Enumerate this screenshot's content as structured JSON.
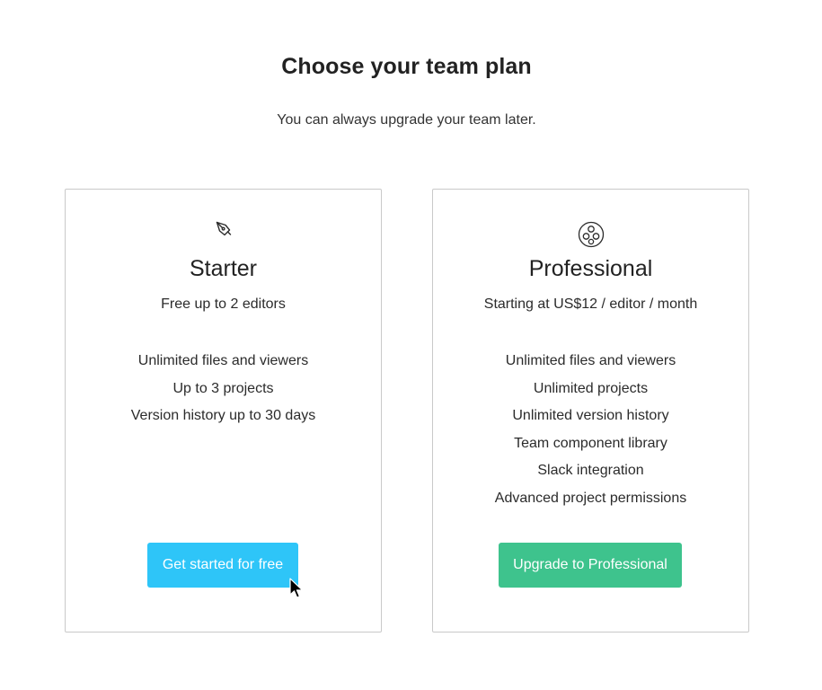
{
  "header": {
    "title": "Choose your team plan",
    "subtitle": "You can always upgrade your team later."
  },
  "plans": [
    {
      "icon": "pen-tool-icon",
      "name": "Starter",
      "price": "Free up to 2 editors",
      "features": [
        "Unlimited files and viewers",
        "Up to 3 projects",
        "Version history up to 30 days"
      ],
      "cta_label": "Get started for free",
      "cta_color": "#2ec5f8"
    },
    {
      "icon": "team-icon",
      "name": "Professional",
      "price": "Starting at US$12 / editor / month",
      "features": [
        "Unlimited files and viewers",
        "Unlimited projects",
        "Unlimited version history",
        "Team component library",
        "Slack integration",
        "Advanced project permissions"
      ],
      "cta_label": "Upgrade to Professional",
      "cta_color": "#3ec38d"
    }
  ],
  "colors": {
    "card_border": "#c9c9c9",
    "text": "#2b2b2b"
  }
}
